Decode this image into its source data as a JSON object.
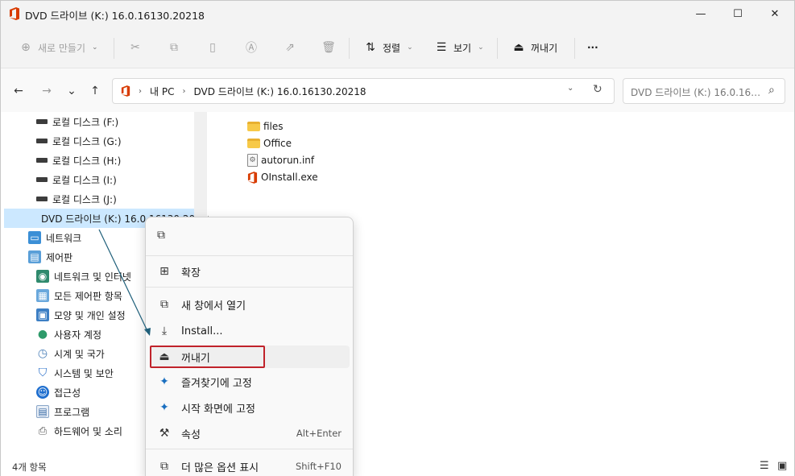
{
  "window": {
    "title": "DVD 드라이브 (K:) 16.0.16130.20218",
    "minimize_glyph": "—",
    "maximize_glyph": "☐",
    "close_glyph": "✕"
  },
  "toolbar": {
    "new_label": "새로 만들기",
    "sort_label": "정렬",
    "view_label": "보기",
    "eject_label": "꺼내기",
    "more_glyph": "···"
  },
  "nav": {
    "back_glyph": "←",
    "forward_glyph": "→",
    "recent_glyph": "⌄",
    "up_glyph": "↑"
  },
  "address": {
    "crumbs": [
      "내 PC",
      "DVD 드라이브 (K:) 16.0.16130.20218"
    ],
    "separator": "›",
    "dropdown_glyph": "⌄",
    "refresh_glyph": "↻"
  },
  "search": {
    "placeholder": "DVD 드라이브 (K:) 16.0.161...",
    "icon_glyph": "⌕"
  },
  "sidebar": {
    "items": [
      {
        "label": "로컬 디스크 (F:)",
        "icon": "drive-icon"
      },
      {
        "label": "로컬 디스크 (G:)",
        "icon": "drive-icon"
      },
      {
        "label": "로컬 디스크 (H:)",
        "icon": "drive-icon"
      },
      {
        "label": "로컬 디스크 (I:)",
        "icon": "drive-icon"
      },
      {
        "label": "로컬 디스크 (J:)",
        "icon": "drive-icon"
      },
      {
        "label": "DVD 드라이브 (K:) 16.0.16130.20218",
        "icon": "office-icon"
      },
      {
        "label": "네트워크",
        "icon": "network-icon"
      },
      {
        "label": "제어판",
        "icon": "control-panel-icon"
      },
      {
        "label": "네트워크 및 인터넷",
        "icon": "network-internet-icon"
      },
      {
        "label": "모든 제어판 항목",
        "icon": "all-control-panel-icon"
      },
      {
        "label": "모양 및 개인 설정",
        "icon": "appearance-icon"
      },
      {
        "label": "사용자 계정",
        "icon": "user-accounts-icon"
      },
      {
        "label": "시계 및 국가",
        "icon": "clock-region-icon"
      },
      {
        "label": "시스템 및 보안",
        "icon": "system-security-icon"
      },
      {
        "label": "접근성",
        "icon": "accessibility-icon"
      },
      {
        "label": "프로그램",
        "icon": "programs-icon"
      },
      {
        "label": "하드웨어 및 소리",
        "icon": "hardware-sound-icon"
      }
    ]
  },
  "files": [
    {
      "name": "files",
      "type": "folder"
    },
    {
      "name": "Office",
      "type": "folder"
    },
    {
      "name": "autorun.inf",
      "type": "file"
    },
    {
      "name": "OInstall.exe",
      "type": "office"
    }
  ],
  "status": {
    "item_count": "4개 항목"
  },
  "context_menu": {
    "items": [
      {
        "label": "확장",
        "icon": "expand-icon",
        "shortcut": ""
      },
      {
        "label": "새 창에서 열기",
        "icon": "open-new-window-icon",
        "shortcut": ""
      },
      {
        "label": "Install...",
        "icon": "install-icon",
        "shortcut": ""
      },
      {
        "label": "꺼내기",
        "icon": "eject-icon",
        "shortcut": ""
      },
      {
        "label": "즐겨찾기에 고정",
        "icon": "pin-icon",
        "shortcut": ""
      },
      {
        "label": "시작 화면에 고정",
        "icon": "pin-start-icon",
        "shortcut": ""
      },
      {
        "label": "속성",
        "icon": "properties-icon",
        "shortcut": "Alt+Enter"
      },
      {
        "label": "더 많은 옵션 표시",
        "icon": "more-options-icon",
        "shortcut": "Shift+F10"
      }
    ]
  },
  "colors": {
    "selection": "#cce8ff",
    "highlight_border": "#c0222a",
    "office_red": "#d83b01",
    "annotation_arrow": "#1f5f7a"
  }
}
